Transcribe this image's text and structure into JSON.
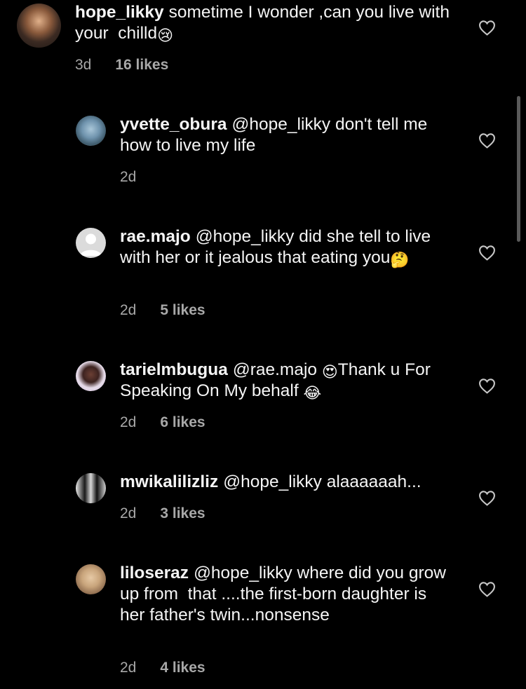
{
  "main_comment": {
    "username": "hope_likky",
    "text": "sometime I wonder ,can you live with your  chilld",
    "emoji": "😢",
    "time": "3d",
    "likes": "16 likes"
  },
  "replies": [
    {
      "username": "yvette_obura",
      "text": "@hope_likky don't tell me how to live my life",
      "time": "2d",
      "likes": ""
    },
    {
      "username": "rae.majo",
      "text": "@hope_likky did she tell to live with her or it jealous that eating you",
      "emoji": "🤔",
      "time": "2d",
      "likes": "5 likes"
    },
    {
      "username": "tarielmbugua",
      "text_before": "@rae.majo ",
      "emoji_inline": "😍",
      "text": "Thank u For Speaking On My behalf ",
      "emoji": "😂",
      "time": "2d",
      "likes": "6 likes"
    },
    {
      "username": "mwikalilizliz",
      "text": "@hope_likky alaaaaaah...",
      "time": "2d",
      "likes": "3 likes"
    },
    {
      "username": "liloseraz",
      "text": "@hope_likky where did you grow up from  that ....the first-born daughter is her father's twin...nonsense",
      "time": "2d",
      "likes": "4 likes"
    }
  ],
  "icons": {
    "like": "heart-outline-icon",
    "default_avatar": "default-avatar-icon"
  }
}
